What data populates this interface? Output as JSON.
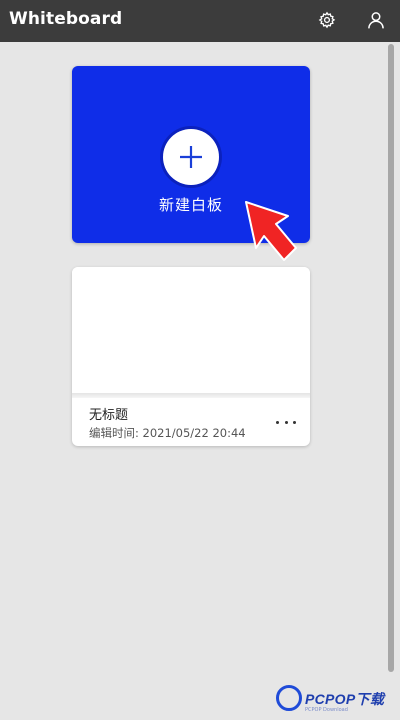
{
  "titlebar": {
    "title": "Whiteboard",
    "icons": [
      "gear-icon",
      "user-icon"
    ]
  },
  "new_board": {
    "label": "新建白板",
    "icon": "plus-icon",
    "color": "#0f2de8"
  },
  "annotation": {
    "arrow_color": "#f02424",
    "arrow_icon": "arrow-pointer-icon"
  },
  "boards": [
    {
      "title": "无标题",
      "edited": "编辑时间: 2021/05/22 20:44",
      "more_icon": "more-horizontal-icon"
    }
  ],
  "watermark": {
    "brand": "PCPOP下载",
    "sub": "PCPOP Download"
  }
}
